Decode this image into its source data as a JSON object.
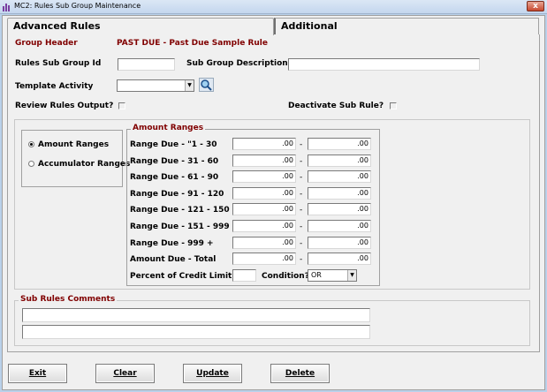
{
  "window": {
    "title": "MC2: Rules Sub Group Maintenance",
    "close_label": "x"
  },
  "tabs": [
    {
      "label": "Advanced Rules"
    },
    {
      "label": "Additional"
    }
  ],
  "header": {
    "group_header_label": "Group Header",
    "group_header_value": "PAST DUE - Past Due Sample Rule",
    "rules_sub_group_id_label": "Rules Sub Group Id",
    "rules_sub_group_id_value": "",
    "sub_group_description_label": "Sub Group Description",
    "sub_group_description_value": "",
    "template_activity_label": "Template Activity",
    "template_activity_value": "",
    "review_rules_output_label": "Review Rules Output?",
    "deactivate_sub_rule_label": "Deactivate Sub Rule?"
  },
  "mode": {
    "amount_ranges_label": "Amount Ranges",
    "accumulator_ranges_label": "Accumulator Ranges",
    "selected": "amount_ranges"
  },
  "amount_ranges": {
    "title": "Amount Ranges",
    "rows": [
      {
        "label": "Range Due - \"1 - 30",
        "from": ".00",
        "to": ".00"
      },
      {
        "label": "Range Due - 31 - 60",
        "from": ".00",
        "to": ".00"
      },
      {
        "label": "Range Due - 61 - 90",
        "from": ".00",
        "to": ".00"
      },
      {
        "label": "Range Due - 91 - 120",
        "from": ".00",
        "to": ".00"
      },
      {
        "label": "Range Due - 121 - 150",
        "from": ".00",
        "to": ".00"
      },
      {
        "label": "Range Due - 151 - 999",
        "from": ".00",
        "to": ".00"
      },
      {
        "label": "Range Due - 999 +",
        "from": ".00",
        "to": ".00"
      },
      {
        "label": "Amount Due - Total",
        "from": ".00",
        "to": ".00"
      }
    ],
    "separator": "-",
    "percent_credit_limit_label": "Percent of Credit Limit",
    "percent_credit_limit_value": "",
    "condition_label": "Condition?",
    "condition_value": "OR"
  },
  "comments": {
    "title": "Sub Rules Comments",
    "line1": "",
    "line2": ""
  },
  "buttons": {
    "exit": "Exit",
    "clear": "Clear",
    "update": "Update",
    "delete": "Delete"
  }
}
